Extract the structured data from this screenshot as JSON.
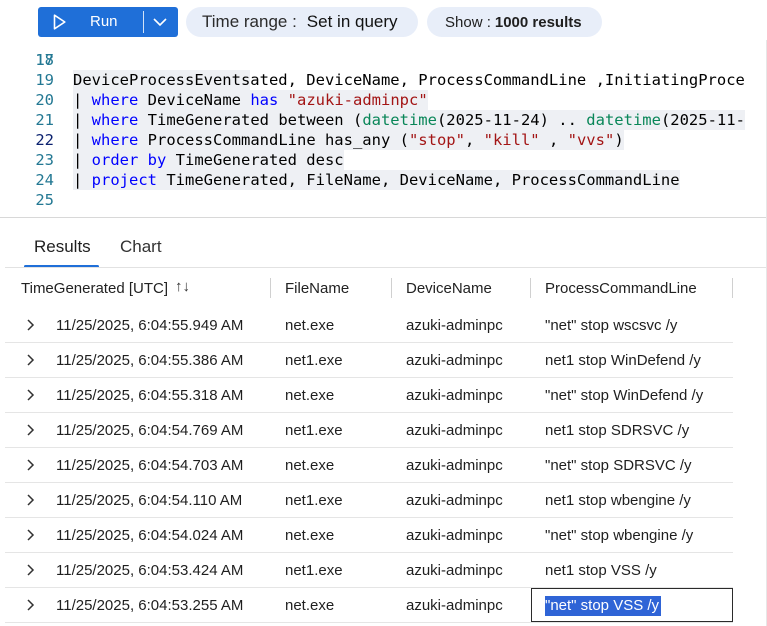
{
  "toolbar": {
    "run_label": "Run",
    "time_range_key": "Time range :",
    "time_range_value": "Set in query",
    "show_key": "Show :",
    "show_value": "1000 results"
  },
  "editor": {
    "partial_line": {
      "num": "17",
      "text": "| project TimeGenerated, DeviceName, ProcessCommandLine ,InitiatingProce"
    },
    "lines": [
      {
        "num": "18",
        "segments": []
      },
      {
        "num": "19",
        "segments": [
          {
            "t": "DeviceProcessEvents",
            "c": "plain"
          }
        ]
      },
      {
        "num": "20",
        "segments": [
          {
            "t": "| ",
            "c": "plain"
          },
          {
            "t": "where",
            "c": "kw"
          },
          {
            "t": " DeviceName ",
            "c": "plain"
          },
          {
            "t": "has",
            "c": "kw"
          },
          {
            "t": " ",
            "c": "plain"
          },
          {
            "t": "\"azuki-adminpc\"",
            "c": "str"
          }
        ]
      },
      {
        "num": "21",
        "segments": [
          {
            "t": "| ",
            "c": "plain"
          },
          {
            "t": "where",
            "c": "kw"
          },
          {
            "t": " TimeGenerated between (",
            "c": "plain"
          },
          {
            "t": "datetime",
            "c": "fn"
          },
          {
            "t": "(2025-11-24) .. ",
            "c": "plain"
          },
          {
            "t": "datetime",
            "c": "fn"
          },
          {
            "t": "(2025-11-",
            "c": "plain"
          }
        ]
      },
      {
        "num": "22",
        "segments": [
          {
            "t": "| ",
            "c": "plain"
          },
          {
            "t": "where",
            "c": "kw"
          },
          {
            "t": " ProcessCommandLine has_any (",
            "c": "plain"
          },
          {
            "t": "\"stop\"",
            "c": "str"
          },
          {
            "t": ", ",
            "c": "plain"
          },
          {
            "t": "\"kill\"",
            "c": "str"
          },
          {
            "t": " , ",
            "c": "plain"
          },
          {
            "t": "\"vvs\"",
            "c": "str"
          },
          {
            "t": ")",
            "c": "plain"
          }
        ]
      },
      {
        "num": "23",
        "segments": [
          {
            "t": "| ",
            "c": "plain"
          },
          {
            "t": "order by",
            "c": "kw"
          },
          {
            "t": " TimeGenerated desc",
            "c": "plain"
          }
        ]
      },
      {
        "num": "24",
        "segments": [
          {
            "t": "| ",
            "c": "plain"
          },
          {
            "t": "project",
            "c": "kw"
          },
          {
            "t": " TimeGenerated, FileName, DeviceName, ProcessCommandLine",
            "c": "plain"
          }
        ]
      },
      {
        "num": "25",
        "segments": []
      }
    ]
  },
  "tabs": {
    "results": "Results",
    "chart": "Chart"
  },
  "grid": {
    "columns": [
      "TimeGenerated [UTC]",
      "FileName",
      "DeviceName",
      "ProcessCommandLine"
    ],
    "rows": [
      {
        "time": "11/25/2025, 6:04:55.949 AM",
        "file": "net.exe",
        "device": "azuki-adminpc",
        "cmd": "\"net\" stop wscsvc /y"
      },
      {
        "time": "11/25/2025, 6:04:55.386 AM",
        "file": "net1.exe",
        "device": "azuki-adminpc",
        "cmd": "net1 stop WinDefend /y"
      },
      {
        "time": "11/25/2025, 6:04:55.318 AM",
        "file": "net.exe",
        "device": "azuki-adminpc",
        "cmd": "\"net\" stop WinDefend /y"
      },
      {
        "time": "11/25/2025, 6:04:54.769 AM",
        "file": "net1.exe",
        "device": "azuki-adminpc",
        "cmd": "net1 stop SDRSVC /y"
      },
      {
        "time": "11/25/2025, 6:04:54.703 AM",
        "file": "net.exe",
        "device": "azuki-adminpc",
        "cmd": "\"net\" stop SDRSVC /y"
      },
      {
        "time": "11/25/2025, 6:04:54.110 AM",
        "file": "net1.exe",
        "device": "azuki-adminpc",
        "cmd": "net1 stop wbengine /y"
      },
      {
        "time": "11/25/2025, 6:04:54.024 AM",
        "file": "net.exe",
        "device": "azuki-adminpc",
        "cmd": "\"net\" stop wbengine /y"
      },
      {
        "time": "11/25/2025, 6:04:53.424 AM",
        "file": "net1.exe",
        "device": "azuki-adminpc",
        "cmd": "net1 stop VSS /y"
      },
      {
        "time": "11/25/2025, 6:04:53.255 AM",
        "file": "net.exe",
        "device": "azuki-adminpc",
        "cmd": "\"net\" stop VSS /y"
      }
    ],
    "selected_row": 8
  },
  "colors": {
    "accent": "#1f6fd8",
    "pill_bg": "#e8eef9",
    "keyword": "#0000ff",
    "string": "#a31515",
    "function": "#098658",
    "selection": "#2f64d6"
  }
}
